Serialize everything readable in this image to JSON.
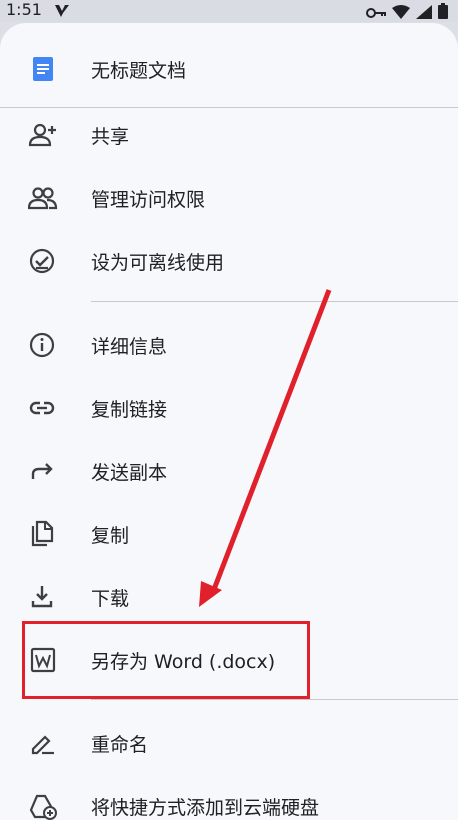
{
  "status_bar": {
    "time": "1:51"
  },
  "document": {
    "title": "无标题文档"
  },
  "menu": [
    {
      "label": "共享",
      "icon": "person-add-icon"
    },
    {
      "label": "管理访问权限",
      "icon": "people-icon"
    },
    {
      "label": "设为可离线使用",
      "icon": "offline-check-icon"
    },
    {
      "label": "详细信息",
      "icon": "info-icon"
    },
    {
      "label": "复制链接",
      "icon": "link-icon"
    },
    {
      "label": "发送副本",
      "icon": "forward-arrow-icon"
    },
    {
      "label": "复制",
      "icon": "copy-icon"
    },
    {
      "label": "下载",
      "icon": "download-icon"
    },
    {
      "label": "另存为 Word (.docx)",
      "icon": "word-icon"
    },
    {
      "label": "重命名",
      "icon": "pencil-icon"
    },
    {
      "label": "将快捷方式添加到云端硬盘",
      "icon": "drive-add-icon"
    }
  ],
  "annotation": {
    "highlight_color": "#e0202a"
  }
}
